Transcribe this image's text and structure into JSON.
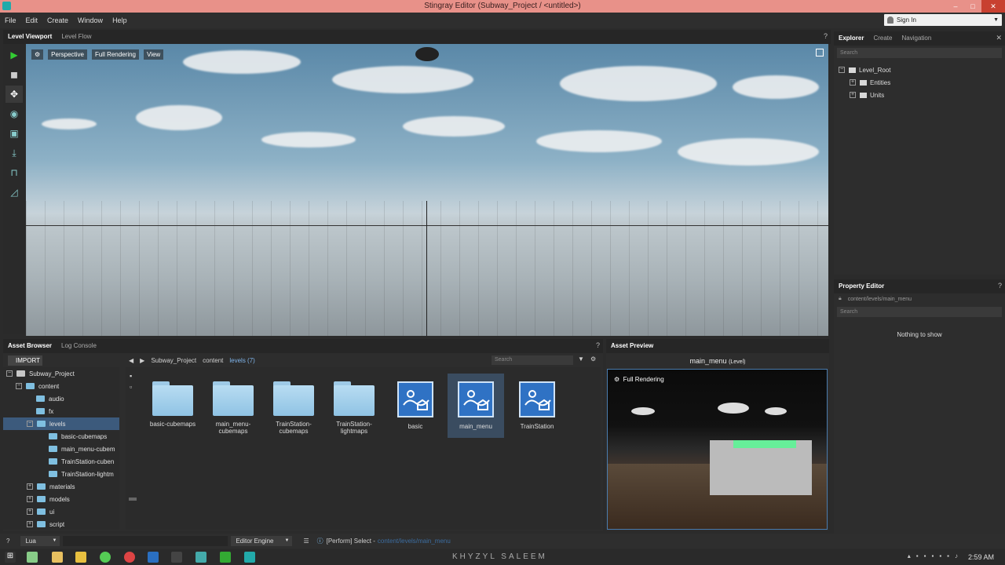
{
  "window": {
    "title": "Stingray Editor (Subway_Project / <untitled>)"
  },
  "menu": [
    "File",
    "Edit",
    "Create",
    "Window",
    "Help"
  ],
  "signin": {
    "label": "Sign In"
  },
  "viewport": {
    "tabs": [
      "Level Viewport",
      "Level Flow"
    ],
    "toolbar": [
      "Perspective",
      "Full Rendering",
      "View"
    ]
  },
  "explorer": {
    "tabs": [
      "Explorer",
      "Create",
      "Navigation"
    ],
    "search_placeholder": "Search",
    "tree": [
      "Level_Root",
      "Entities",
      "Units"
    ]
  },
  "property_editor": {
    "tab": "Property Editor",
    "path": "content/levels/main_menu",
    "search_placeholder": "Search",
    "empty": "Nothing to show"
  },
  "asset_browser": {
    "tabs": [
      "Asset Browser",
      "Log Console"
    ],
    "import_label": "IMPORT",
    "breadcrumb": [
      "Subway_Project",
      "content",
      "levels (7)"
    ],
    "search_placeholder": "Search",
    "tree": [
      "Subway_Project",
      "content",
      "audio",
      "fx",
      "levels",
      "basic-cubemaps",
      "main_menu-cubem",
      "TrainStation-cuben",
      "TrainStation-lightm",
      "materials",
      "models",
      "ui",
      "script"
    ],
    "assets": [
      "basic-cubemaps",
      "main_menu-cubemaps",
      "TrainStation-cubemaps",
      "TrainStation-lightmaps",
      "basic",
      "main_menu",
      "TrainStation"
    ]
  },
  "asset_preview": {
    "tab": "Asset Preview",
    "title": "main_menu",
    "title_suffix": "(Level)",
    "mode": "Full Rendering"
  },
  "status": {
    "language": "Lua",
    "engine": "Editor Engine",
    "message": "[Perform] Select -",
    "message_path": "content/levels/main_menu"
  },
  "watermark": "KHYZYL SALEEM",
  "clock": "2:59 AM"
}
